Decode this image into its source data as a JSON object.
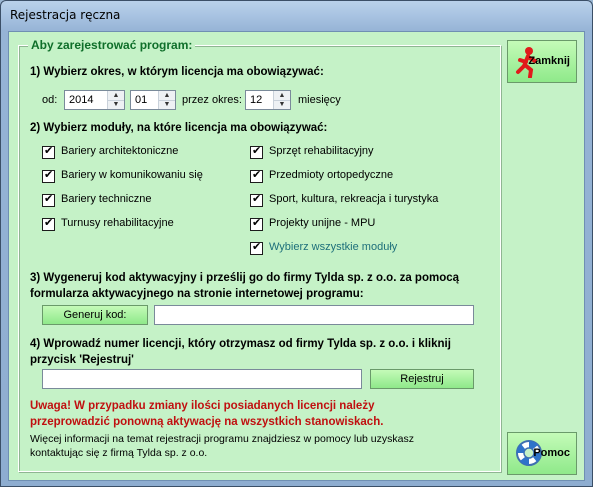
{
  "window": {
    "title": "Rejestracja ręczna"
  },
  "group": {
    "title": "Aby zarejestrować program:"
  },
  "step1": {
    "heading": "1)  Wybierz okres, w którym licencja ma obowiązywać:",
    "from_label": "od:",
    "year": "2014",
    "month": "01",
    "period_label": "przez okres:",
    "months_count": "12",
    "months_unit": "miesięcy"
  },
  "step2": {
    "heading": "2)  Wybierz moduły, na które licencja ma obowiązywać:",
    "left_modules": [
      {
        "label": "Bariery architektoniczne",
        "checked": true
      },
      {
        "label": "Bariery w komunikowaniu się",
        "checked": true
      },
      {
        "label": "Bariery techniczne",
        "checked": true
      },
      {
        "label": "Turnusy rehabilitacyjne",
        "checked": true
      }
    ],
    "right_modules": [
      {
        "label": "Sprzęt rehabilitacyjny",
        "checked": true
      },
      {
        "label": "Przedmioty ortopedyczne",
        "checked": true
      },
      {
        "label": "Sport, kultura, rekreacja i turystyka",
        "checked": true
      },
      {
        "label": "Projekty unijne - MPU",
        "checked": true
      },
      {
        "label": "Wybierz wszystkie moduły",
        "checked": true
      }
    ]
  },
  "step3": {
    "heading_line1": "3)  Wygeneruj kod aktywacyjny i prześlij go do firmy Tylda sp. z o.o. za pomocą",
    "heading_line2": "formularza aktywacyjnego na stronie internetowej programu:",
    "generate_label": "Generuj kod:",
    "code_value": ""
  },
  "step4": {
    "heading_line1": "4)  Wprowadź numer licencji, który otrzymasz od firmy Tylda sp. z o.o. i kliknij",
    "heading_line2": "przycisk 'Rejestruj'",
    "license_value": "",
    "register_label": "Rejestruj"
  },
  "warning": {
    "line1": "Uwaga! W przypadku zmiany ilości posiadanych licencji należy",
    "line2": "przeprowadzić ponowną aktywację na wszystkich stanowiskach."
  },
  "info": {
    "line1": "Więcej informacji na temat rejestracji programu znajdziesz w pomocy lub uzyskasz",
    "line2": "kontaktując się z firmą Tylda sp. z o.o."
  },
  "buttons": {
    "close_label": "Zamknij",
    "help_label": "Pomoc"
  },
  "icons": {
    "close": "running-man-icon",
    "help": "lifebuoy-icon"
  },
  "colors": {
    "panel_bg": "#c5f2c7",
    "button_green": "#8fe98a",
    "warning_red": "#c01010",
    "group_title": "#0f6f2a"
  }
}
